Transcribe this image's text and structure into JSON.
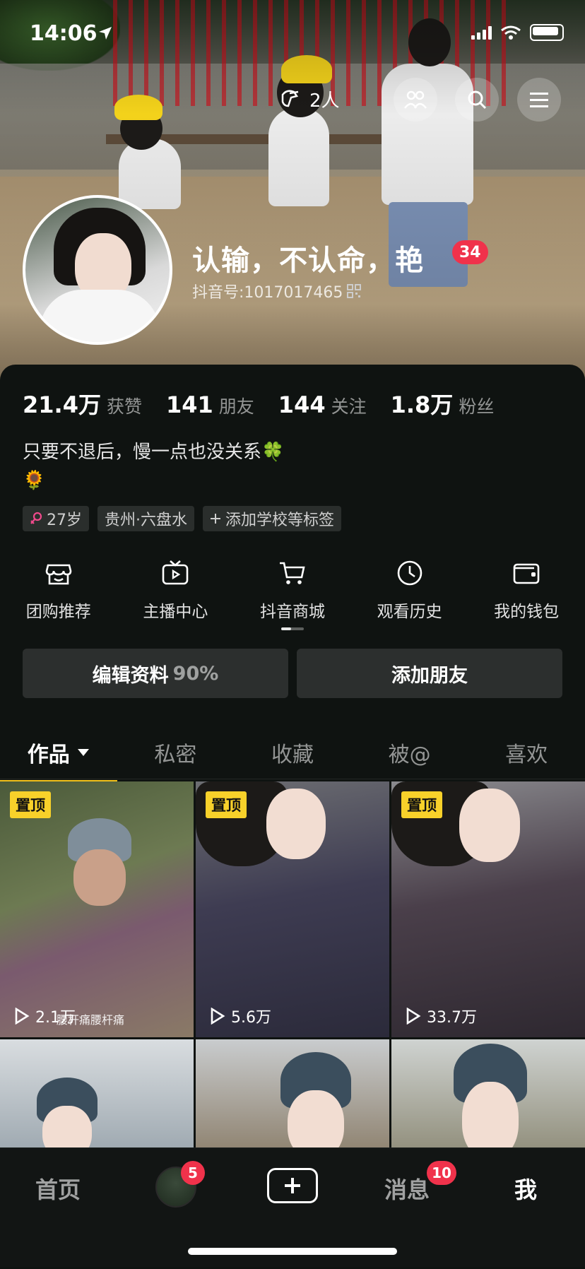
{
  "status_bar": {
    "time": "14:06"
  },
  "header": {
    "visitors": "2人",
    "username": "认输，不认命，艳",
    "level": "34",
    "douyin_id": "抖音号:1017017465"
  },
  "stats": [
    {
      "value": "21.4万",
      "label": "获赞"
    },
    {
      "value": "141",
      "label": "朋友"
    },
    {
      "value": "144",
      "label": "关注"
    },
    {
      "value": "1.8万",
      "label": "粉丝"
    }
  ],
  "bio": {
    "line1": "只要不退后，慢一点也没关系🍀",
    "line2": "🌻"
  },
  "tags": {
    "age": "27岁",
    "location": "贵州·六盘水",
    "add": "添加学校等标签"
  },
  "shortcuts": [
    {
      "icon": "shop-icon",
      "label": "团购推荐"
    },
    {
      "icon": "tv-icon",
      "label": "主播中心"
    },
    {
      "icon": "cart-icon",
      "label": "抖音商城"
    },
    {
      "icon": "clock-icon",
      "label": "观看历史"
    },
    {
      "icon": "wallet-icon",
      "label": "我的钱包"
    }
  ],
  "buttons": {
    "edit": "编辑资料",
    "edit_pct": "90%",
    "add_friend": "添加朋友"
  },
  "tabs": [
    "作品",
    "私密",
    "收藏",
    "被@",
    "喜欢"
  ],
  "videos": [
    {
      "pinned": "置顶",
      "plays": "2.1万",
      "caption": "腰杆痛腰杆痛"
    },
    {
      "pinned": "置顶",
      "plays": "5.6万"
    },
    {
      "pinned": "置顶",
      "plays": "33.7万"
    },
    {},
    {},
    {}
  ],
  "bottom_nav": {
    "home": "首页",
    "friends_badge": "5",
    "messages": "消息",
    "messages_badge": "10",
    "me": "我"
  },
  "colors": {
    "accent_yellow": "#f2c01a",
    "badge_red": "#f0324b",
    "background": "#0f1311"
  }
}
